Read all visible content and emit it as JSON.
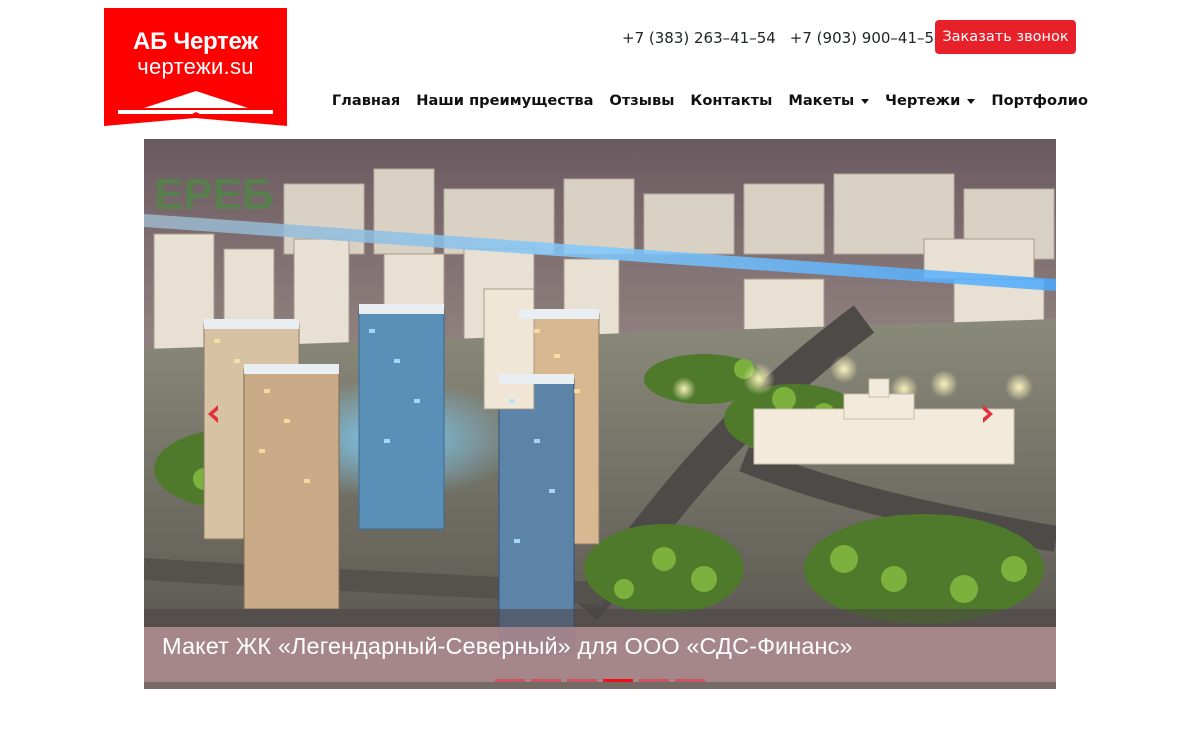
{
  "logo": {
    "title": "АБ Чертеж",
    "subtitle": "чертежи.su",
    "color": "#ff0000"
  },
  "header": {
    "phones": [
      "+7 (383) 263–41–54",
      "+7 (903) 900–41–54"
    ],
    "call_button_label": "Заказать звонок",
    "call_button_color": "#e8202a"
  },
  "nav": {
    "items": [
      {
        "label": "Главная",
        "dropdown": false
      },
      {
        "label": "Наши преимущества",
        "dropdown": false
      },
      {
        "label": "Отзывы",
        "dropdown": false
      },
      {
        "label": "Контакты",
        "dropdown": false
      },
      {
        "label": "Макеты",
        "dropdown": true
      },
      {
        "label": "Чертежи",
        "dropdown": true
      },
      {
        "label": "Портфолио",
        "dropdown": false
      }
    ]
  },
  "carousel": {
    "caption": "Макет ЖК «Легендарный-Северный» для ООО «СДС-Финанс»",
    "slide_count": 6,
    "active_slide": 4,
    "prev_icon": "chevron-left-icon",
    "next_icon": "chevron-right-icon",
    "accent_color": "#e0303a"
  }
}
